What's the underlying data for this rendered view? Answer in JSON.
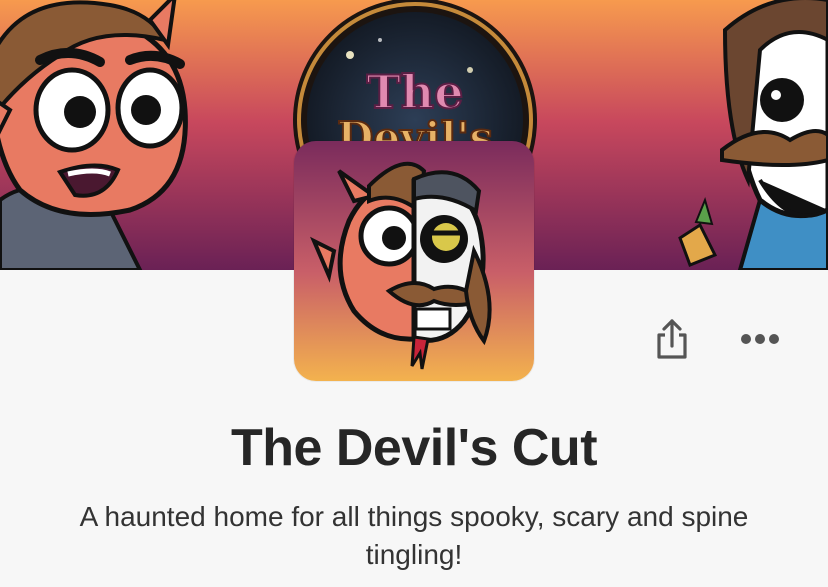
{
  "colors": {
    "banner_top": "#f79a4e",
    "banner_mid": "#c8485d",
    "banner_bottom": "#6a2155",
    "page_background": "#f7f7f7",
    "text_primary": "#262626",
    "icon": "#555555"
  },
  "banner": {
    "logo_text_line1": "The",
    "logo_text_line2": "Devil's"
  },
  "profile": {
    "title": "The Devil's Cut",
    "tagline": "A haunted home for all things spooky, scary and spine tingling!"
  },
  "actions": {
    "share_icon": "share-icon",
    "more_icon": "ellipsis-icon"
  }
}
